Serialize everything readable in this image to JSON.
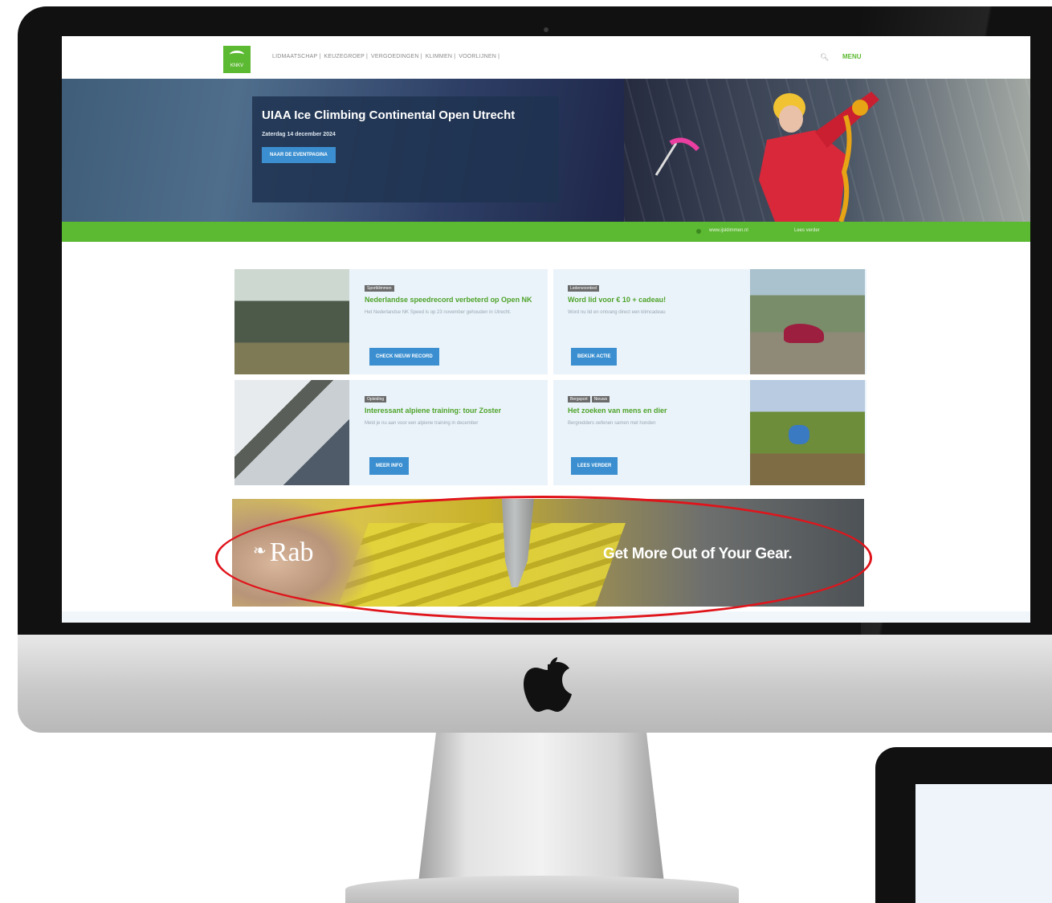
{
  "nav": {
    "logo_text": "KNKV",
    "items": [
      "LIDMAATSCHAP |",
      "KEUZEGROEP |",
      "VERGOEDINGEN |",
      "KLIMMEN |",
      "VOORLIJNEN |"
    ],
    "menu_label": "MENU"
  },
  "hero": {
    "title": "UIAA Ice Climbing Continental Open Utrecht",
    "date": "Zaterdag 14 december 2024",
    "button_label": "NAAR DE EVENTPAGINA"
  },
  "greenbar": {
    "link1": "www.ijsklimmen.nl",
    "link2": "Lees verder"
  },
  "cards": [
    {
      "tag": "Sportklimmen",
      "title": "Nederlandse speedrecord verbeterd op Open NK",
      "desc": "Het Nederlandse NK Speed is op 23 november gehouden in Utrecht.",
      "button": "CHECK NIEUW RECORD"
    },
    {
      "tag": "Ledenvoordeel",
      "title": "Word lid voor € 10 + cadeau!",
      "desc": "Word nu lid en ontvang direct een klimcadeau",
      "button": "BEKIJK ACTIE"
    },
    {
      "tag": "Opleiding",
      "title": "Interessant alpiene training: tour Zoster",
      "desc": "Meld je nu aan voor een alpiene training in december",
      "button": "MEER INFO"
    },
    {
      "tag1": "Bergsport",
      "tag2": "Nieuws",
      "title": "Het zoeken van mens en dier",
      "desc": "Bergredders oefenen samen met honden",
      "button": "LEES VERDER"
    }
  ],
  "banner": {
    "brand": "Rab",
    "tagline": "Get More Out of Your Gear."
  },
  "colors": {
    "brand_green": "#5cb932",
    "button_blue": "#3b8fd0",
    "annotation_red": "#e0141b"
  }
}
